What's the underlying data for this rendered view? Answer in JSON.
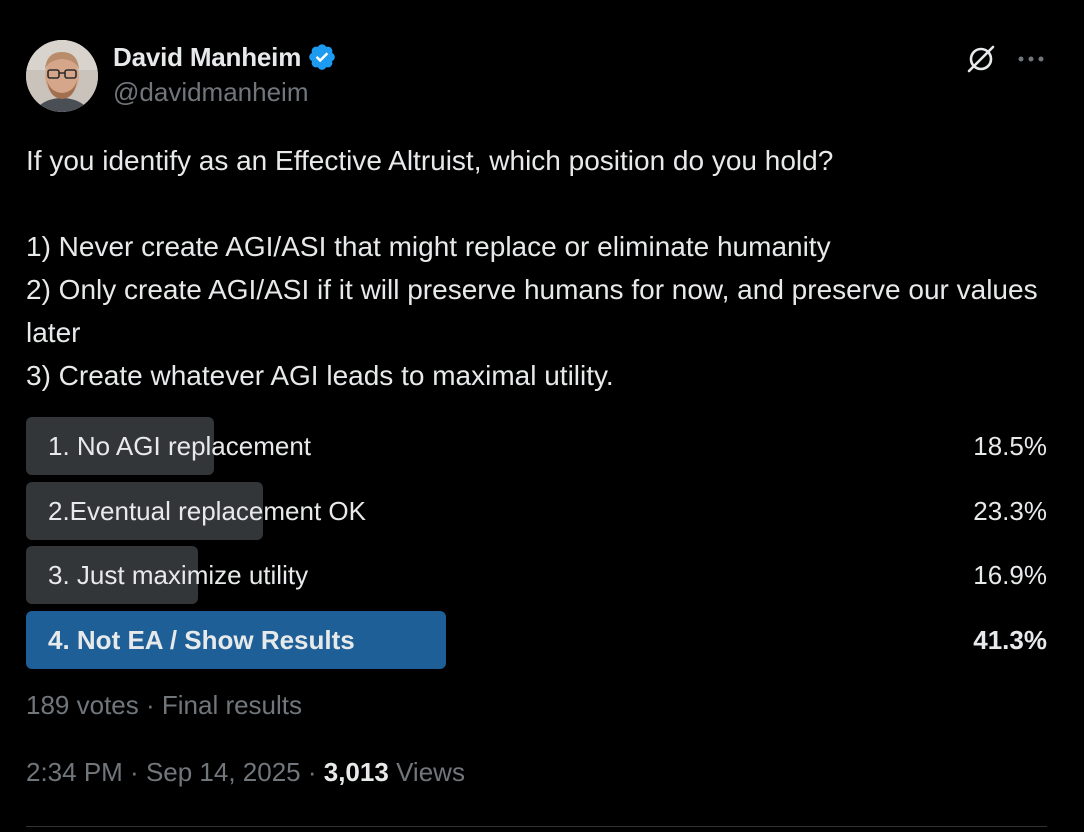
{
  "author": {
    "display_name": "David Manheim",
    "handle": "@davidmanheim",
    "verified_icon": "verified-badge-icon",
    "verified_color": "#1d9bf0"
  },
  "header_actions": {
    "grok_icon": "grok-icon",
    "more_icon": "more-horizontal-icon"
  },
  "tweet": {
    "lines": [
      "If you identify as an Effective Altruist, which position do you hold?",
      "",
      "1) Never create AGI/ASI that might replace or eliminate humanity",
      "2) Only create AGI/ASI if it will preserve humans for now, and preserve our values later",
      "3) Create whatever AGI leads to maximal utility."
    ]
  },
  "poll": {
    "options": [
      {
        "label": "1. No AGI replacement",
        "percent_text": "18.5%",
        "percent": 18.5,
        "winner": false
      },
      {
        "label": "2.Eventual replacement OK",
        "percent_text": "23.3%",
        "percent": 23.3,
        "winner": false
      },
      {
        "label": "3. Just maximize utility",
        "percent_text": "16.9%",
        "percent": 16.9,
        "winner": false
      },
      {
        "label": "4. Not EA / Show Results",
        "percent_text": "41.3%",
        "percent": 41.3,
        "winner": true
      }
    ],
    "votes_text": "189 votes",
    "separator": " · ",
    "status_text": "Final results",
    "bar_color": "#333639",
    "winner_color": "#1d5f96"
  },
  "meta": {
    "time": "2:34 PM",
    "date": "Sep 14, 2025",
    "separator": " · ",
    "views_count": "3,013",
    "views_label": "Views"
  }
}
